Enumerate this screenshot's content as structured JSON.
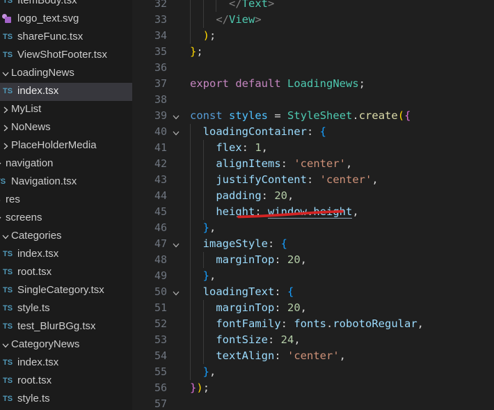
{
  "colors": {
    "editor_bg": "#1f1f1f",
    "sidebar_bg": "#1b1b1b",
    "selected_row_bg": "#37373d",
    "sidebar_text": "#cccccc",
    "line_number": "#6f7680",
    "ts_icon_blue": "#519aba",
    "svg_icon_purple": "#a362c8",
    "annotation_red": "#d32424"
  },
  "sidebar": {
    "items": [
      {
        "label": "ItemBody.tsx",
        "kind": "ts-file",
        "depth": "deep",
        "selected": false
      },
      {
        "label": "logo_text.svg",
        "kind": "svg-file",
        "depth": "deep",
        "selected": false
      },
      {
        "label": "shareFunc.tsx",
        "kind": "ts-file",
        "depth": "deep",
        "selected": false
      },
      {
        "label": "ViewShotFooter.tsx",
        "kind": "ts-file",
        "depth": "deep",
        "selected": false
      },
      {
        "label": "LoadingNews",
        "kind": "folder",
        "depth": "mid",
        "expanded": true
      },
      {
        "label": "index.tsx",
        "kind": "ts-file",
        "depth": "deep",
        "selected": true
      },
      {
        "label": "MyList",
        "kind": "folder",
        "depth": "mid",
        "expanded": false
      },
      {
        "label": "NoNews",
        "kind": "folder",
        "depth": "mid",
        "expanded": false
      },
      {
        "label": "PlaceHolderMedia",
        "kind": "folder",
        "depth": "mid",
        "expanded": false
      },
      {
        "label": "navigation",
        "kind": "folder",
        "depth": "shallow",
        "expanded": true
      },
      {
        "label": "Navigation.tsx",
        "kind": "ts-file",
        "depth": "mid",
        "selected": false
      },
      {
        "label": "res",
        "kind": "folder",
        "depth": "shallow",
        "expanded": false
      },
      {
        "label": "screens",
        "kind": "folder",
        "depth": "shallow",
        "expanded": true
      },
      {
        "label": "Categories",
        "kind": "folder",
        "depth": "mid",
        "expanded": true
      },
      {
        "label": "index.tsx",
        "kind": "ts-file",
        "depth": "deep",
        "selected": false
      },
      {
        "label": "root.tsx",
        "kind": "ts-file",
        "depth": "deep",
        "selected": false
      },
      {
        "label": "SingleCategory.tsx",
        "kind": "ts-file",
        "depth": "deep",
        "selected": false
      },
      {
        "label": "style.ts",
        "kind": "ts-file",
        "depth": "deep",
        "selected": false
      },
      {
        "label": "test_BlurBGg.tsx",
        "kind": "ts-file",
        "depth": "deep",
        "selected": false
      },
      {
        "label": "CategoryNews",
        "kind": "folder",
        "depth": "mid",
        "expanded": true
      },
      {
        "label": "index.tsx",
        "kind": "ts-file",
        "depth": "deep",
        "selected": false
      },
      {
        "label": "root.tsx",
        "kind": "ts-file",
        "depth": "deep",
        "selected": false
      },
      {
        "label": "style.ts",
        "kind": "ts-file",
        "depth": "deep",
        "selected": false
      }
    ]
  },
  "editor": {
    "lines": [
      {
        "num": 32,
        "guides": 3,
        "fold": false,
        "tokens": [
          [
            "ws",
            "      "
          ],
          [
            "tagp",
            "</"
          ],
          [
            "cls",
            "Text"
          ],
          [
            "tagp",
            ">"
          ]
        ]
      },
      {
        "num": 33,
        "guides": 2,
        "fold": false,
        "tokens": [
          [
            "ws",
            "    "
          ],
          [
            "tagp",
            "</"
          ],
          [
            "cls",
            "View"
          ],
          [
            "tagp",
            ">"
          ]
        ]
      },
      {
        "num": 34,
        "guides": 1,
        "fold": false,
        "tokens": [
          [
            "ws",
            "  "
          ],
          [
            "b1",
            ")"
          ],
          [
            "pun",
            ";"
          ]
        ]
      },
      {
        "num": 35,
        "guides": 0,
        "fold": false,
        "tokens": [
          [
            "b1",
            "}"
          ],
          [
            "pun",
            ";"
          ]
        ]
      },
      {
        "num": 36,
        "guides": 0,
        "fold": false,
        "tokens": []
      },
      {
        "num": 37,
        "guides": 0,
        "fold": false,
        "tokens": [
          [
            "ctrl",
            "export"
          ],
          [
            "ws",
            " "
          ],
          [
            "ctrl",
            "default"
          ],
          [
            "ws",
            " "
          ],
          [
            "cls",
            "LoadingNews"
          ],
          [
            "pun",
            ";"
          ]
        ]
      },
      {
        "num": 38,
        "guides": 0,
        "fold": false,
        "tokens": []
      },
      {
        "num": 39,
        "guides": 0,
        "fold": true,
        "tokens": [
          [
            "kw",
            "const"
          ],
          [
            "ws",
            " "
          ],
          [
            "var",
            "styles"
          ],
          [
            "ws",
            " "
          ],
          [
            "pun",
            "="
          ],
          [
            "ws",
            " "
          ],
          [
            "cls",
            "StyleSheet"
          ],
          [
            "pun",
            "."
          ],
          [
            "fn",
            "create"
          ],
          [
            "b1",
            "("
          ],
          [
            "b2",
            "{"
          ]
        ]
      },
      {
        "num": 40,
        "guides": 1,
        "fold": true,
        "tokens": [
          [
            "ws",
            "  "
          ],
          [
            "prop",
            "loadingContainer"
          ],
          [
            "pun",
            ": "
          ],
          [
            "b3",
            "{"
          ]
        ]
      },
      {
        "num": 41,
        "guides": 2,
        "fold": false,
        "tokens": [
          [
            "ws",
            "    "
          ],
          [
            "prop",
            "flex"
          ],
          [
            "pun",
            ": "
          ],
          [
            "num",
            "1"
          ],
          [
            "pun",
            ","
          ]
        ]
      },
      {
        "num": 42,
        "guides": 2,
        "fold": false,
        "tokens": [
          [
            "ws",
            "    "
          ],
          [
            "prop",
            "alignItems"
          ],
          [
            "pun",
            ": "
          ],
          [
            "str",
            "'center'"
          ],
          [
            "pun",
            ","
          ]
        ]
      },
      {
        "num": 43,
        "guides": 2,
        "fold": false,
        "tokens": [
          [
            "ws",
            "    "
          ],
          [
            "prop",
            "justifyContent"
          ],
          [
            "pun",
            ": "
          ],
          [
            "str",
            "'center'"
          ],
          [
            "pun",
            ","
          ]
        ]
      },
      {
        "num": 44,
        "guides": 2,
        "fold": false,
        "tokens": [
          [
            "ws",
            "    "
          ],
          [
            "prop",
            "padding"
          ],
          [
            "pun",
            ": "
          ],
          [
            "num",
            "20"
          ],
          [
            "pun",
            ","
          ]
        ]
      },
      {
        "num": 45,
        "guides": 2,
        "fold": false,
        "tokens": [
          [
            "ws",
            "    "
          ],
          [
            "prop",
            "height"
          ],
          [
            "pun",
            ": "
          ],
          [
            "prop u",
            "window"
          ],
          [
            "pun u",
            "."
          ],
          [
            "prop u",
            "height"
          ],
          [
            "pun",
            ","
          ]
        ]
      },
      {
        "num": 46,
        "guides": 1,
        "fold": false,
        "tokens": [
          [
            "ws",
            "  "
          ],
          [
            "b3",
            "}"
          ],
          [
            "pun",
            ","
          ]
        ]
      },
      {
        "num": 47,
        "guides": 1,
        "fold": true,
        "tokens": [
          [
            "ws",
            "  "
          ],
          [
            "prop",
            "imageStyle"
          ],
          [
            "pun",
            ": "
          ],
          [
            "b3",
            "{"
          ]
        ]
      },
      {
        "num": 48,
        "guides": 2,
        "fold": false,
        "tokens": [
          [
            "ws",
            "    "
          ],
          [
            "prop",
            "marginTop"
          ],
          [
            "pun",
            ": "
          ],
          [
            "num",
            "20"
          ],
          [
            "pun",
            ","
          ]
        ]
      },
      {
        "num": 49,
        "guides": 1,
        "fold": false,
        "tokens": [
          [
            "ws",
            "  "
          ],
          [
            "b3",
            "}"
          ],
          [
            "pun",
            ","
          ]
        ]
      },
      {
        "num": 50,
        "guides": 1,
        "fold": true,
        "tokens": [
          [
            "ws",
            "  "
          ],
          [
            "prop",
            "loadingText"
          ],
          [
            "pun",
            ": "
          ],
          [
            "b3",
            "{"
          ]
        ]
      },
      {
        "num": 51,
        "guides": 2,
        "fold": false,
        "tokens": [
          [
            "ws",
            "    "
          ],
          [
            "prop",
            "marginTop"
          ],
          [
            "pun",
            ": "
          ],
          [
            "num",
            "20"
          ],
          [
            "pun",
            ","
          ]
        ]
      },
      {
        "num": 52,
        "guides": 2,
        "fold": false,
        "tokens": [
          [
            "ws",
            "    "
          ],
          [
            "prop",
            "fontFamily"
          ],
          [
            "pun",
            ": "
          ],
          [
            "prop",
            "fonts"
          ],
          [
            "pun",
            "."
          ],
          [
            "prop",
            "robotoRegular"
          ],
          [
            "pun",
            ","
          ]
        ]
      },
      {
        "num": 53,
        "guides": 2,
        "fold": false,
        "tokens": [
          [
            "ws",
            "    "
          ],
          [
            "prop",
            "fontSize"
          ],
          [
            "pun",
            ": "
          ],
          [
            "num",
            "24"
          ],
          [
            "pun",
            ","
          ]
        ]
      },
      {
        "num": 54,
        "guides": 2,
        "fold": false,
        "tokens": [
          [
            "ws",
            "    "
          ],
          [
            "prop",
            "textAlign"
          ],
          [
            "pun",
            ": "
          ],
          [
            "str",
            "'center'"
          ],
          [
            "pun",
            ","
          ]
        ]
      },
      {
        "num": 55,
        "guides": 1,
        "fold": false,
        "tokens": [
          [
            "ws",
            "  "
          ],
          [
            "b3",
            "}"
          ],
          [
            "pun",
            ","
          ]
        ]
      },
      {
        "num": 56,
        "guides": 0,
        "fold": false,
        "tokens": [
          [
            "b2",
            "}"
          ],
          [
            "b1",
            ")"
          ],
          [
            "pun",
            ";"
          ]
        ]
      },
      {
        "num": 57,
        "guides": 0,
        "fold": false,
        "tokens": []
      }
    ],
    "annotation": {
      "type": "hand-drawn-red-underline",
      "target_text": "window.height",
      "target_line": 45,
      "color": "#d32424"
    }
  }
}
